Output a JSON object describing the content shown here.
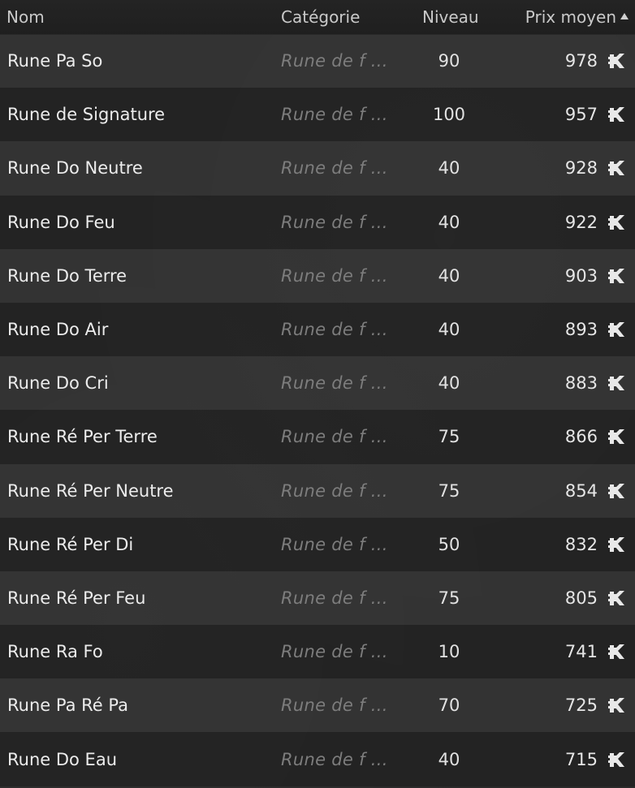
{
  "header": {
    "name": "Nom",
    "category": "Catégorie",
    "level": "Niveau",
    "price": "Prix moyen"
  },
  "sort": {
    "column": "price",
    "direction": "ascending-arrow"
  },
  "currency_icon": "kama-icon",
  "rows": [
    {
      "name": "Rune Pa So",
      "category": "Rune de f ...",
      "level": "90",
      "price": "978"
    },
    {
      "name": "Rune de Signature",
      "category": "Rune de f ...",
      "level": "100",
      "price": "957"
    },
    {
      "name": "Rune Do Neutre",
      "category": "Rune de f ...",
      "level": "40",
      "price": "928"
    },
    {
      "name": "Rune Do Feu",
      "category": "Rune de f ...",
      "level": "40",
      "price": "922"
    },
    {
      "name": "Rune Do Terre",
      "category": "Rune de f ...",
      "level": "40",
      "price": "903"
    },
    {
      "name": "Rune Do Air",
      "category": "Rune de f ...",
      "level": "40",
      "price": "893"
    },
    {
      "name": "Rune Do Cri",
      "category": "Rune de f ...",
      "level": "40",
      "price": "883"
    },
    {
      "name": "Rune Ré Per Terre",
      "category": "Rune de f ...",
      "level": "75",
      "price": "866"
    },
    {
      "name": "Rune Ré Per Neutre",
      "category": "Rune de f ...",
      "level": "75",
      "price": "854"
    },
    {
      "name": "Rune Ré Per Di",
      "category": "Rune de f ...",
      "level": "50",
      "price": "832"
    },
    {
      "name": "Rune Ré Per Feu",
      "category": "Rune de f ...",
      "level": "75",
      "price": "805"
    },
    {
      "name": "Rune Ra Fo",
      "category": "Rune de f ...",
      "level": "10",
      "price": "741"
    },
    {
      "name": "Rune Pa Ré Pa",
      "category": "Rune de f ...",
      "level": "70",
      "price": "725"
    },
    {
      "name": "Rune Do Eau",
      "category": "Rune de f ...",
      "level": "40",
      "price": "715"
    }
  ]
}
